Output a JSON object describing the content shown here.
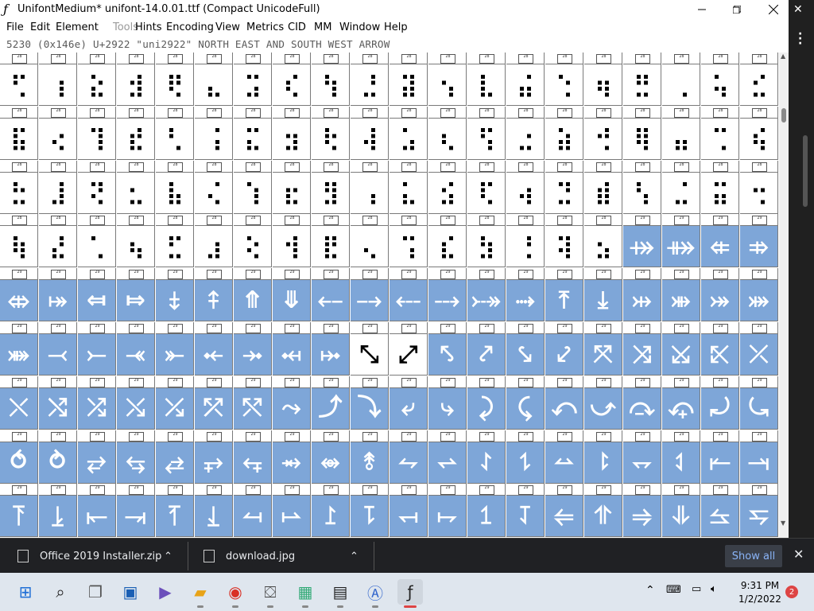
{
  "window": {
    "title": "UnifontMedium*  unifont-14.0.01.ttf (Compact UnicodeFull)",
    "app_icon": "fontforge-icon"
  },
  "menu": {
    "items": [
      {
        "label": "File",
        "enabled": true
      },
      {
        "label": "Edit",
        "enabled": true
      },
      {
        "label": "Element",
        "enabled": true
      },
      {
        "label": "Tools",
        "enabled": false
      },
      {
        "label": "Hints",
        "enabled": true
      },
      {
        "label": "Encoding",
        "enabled": true
      },
      {
        "label": "View",
        "enabled": true
      },
      {
        "label": "Metrics",
        "enabled": true
      },
      {
        "label": "CID",
        "enabled": true
      },
      {
        "label": "MM",
        "enabled": true
      },
      {
        "label": "Window",
        "enabled": true
      },
      {
        "label": "Help",
        "enabled": true
      }
    ]
  },
  "info": {
    "text": "5230 (0x146e) U+2922 \"uni2922\" NORTH EAST AND SOUTH WEST ARROW"
  },
  "grid": {
    "colors": {
      "defined_bg": "#ffffff",
      "empty_bg": "#7ea6d8",
      "border": "#7a7a7a"
    },
    "rows": [
      {
        "labels": [
          "28",
          "28",
          "28",
          "28",
          "28",
          "28",
          "28",
          "28",
          "28",
          "28",
          "28",
          "28",
          "28",
          "28",
          "28",
          "28",
          "28",
          "28",
          "28",
          "28"
        ],
        "kind": [
          "w",
          "w",
          "w",
          "w",
          "w",
          "w",
          "w",
          "w",
          "w",
          "w",
          "w",
          "w",
          "w",
          "w",
          "w",
          "w",
          "w",
          "w",
          "w",
          "w"
        ],
        "glyph": "braille"
      },
      {
        "labels": [
          "28",
          "28",
          "28",
          "28",
          "28",
          "28",
          "28",
          "28",
          "28",
          "28",
          "28",
          "28",
          "28",
          "28",
          "28",
          "28",
          "28",
          "28",
          "28",
          "28"
        ],
        "kind": [
          "w",
          "w",
          "w",
          "w",
          "w",
          "w",
          "w",
          "w",
          "w",
          "w",
          "w",
          "w",
          "w",
          "w",
          "w",
          "w",
          "w",
          "w",
          "w",
          "w"
        ],
        "glyph": "braille"
      },
      {
        "labels": [
          "28",
          "28",
          "28",
          "28",
          "28",
          "28",
          "28",
          "28",
          "28",
          "28",
          "28",
          "28",
          "28",
          "28",
          "28",
          "28",
          "28",
          "28",
          "28",
          "28"
        ],
        "kind": [
          "w",
          "w",
          "w",
          "w",
          "w",
          "w",
          "w",
          "w",
          "w",
          "w",
          "w",
          "w",
          "w",
          "w",
          "w",
          "w",
          "w",
          "w",
          "w",
          "w"
        ],
        "glyph": "braille"
      },
      {
        "labels": [
          "28",
          "28",
          "28",
          "28",
          "28",
          "28",
          "28",
          "28",
          "28",
          "28",
          "28",
          "28",
          "28",
          "28",
          "28",
          "28",
          "29",
          "29",
          "29",
          "29"
        ],
        "kind": [
          "w",
          "w",
          "w",
          "w",
          "w",
          "w",
          "w",
          "w",
          "w",
          "w",
          "w",
          "w",
          "w",
          "w",
          "w",
          "w",
          "b",
          "b",
          "b",
          "b"
        ],
        "glyph": "braille-then-arrows"
      },
      {
        "labels": [
          "29",
          "29",
          "29",
          "29",
          "29",
          "29",
          "29",
          "29",
          "29",
          "29",
          "29",
          "29",
          "29",
          "29",
          "29",
          "29",
          "29",
          "29",
          "29",
          "29"
        ],
        "kind": [
          "b",
          "b",
          "b",
          "b",
          "b",
          "b",
          "b",
          "b",
          "b",
          "b",
          "b",
          "b",
          "b",
          "b",
          "b",
          "b",
          "b",
          "b",
          "b",
          "b"
        ],
        "glyph": "arrows"
      },
      {
        "labels": [
          "29",
          "29",
          "29",
          "29",
          "29",
          "29",
          "29",
          "29",
          "29",
          "29",
          "29",
          "29",
          "29",
          "29",
          "29",
          "29",
          "29",
          "29",
          "29",
          "29"
        ],
        "kind": [
          "b",
          "b",
          "b",
          "b",
          "b",
          "b",
          "b",
          "b",
          "b",
          "w",
          "w",
          "b",
          "b",
          "b",
          "b",
          "b",
          "b",
          "b",
          "b",
          "b"
        ],
        "glyph": "arrows"
      },
      {
        "labels": [
          "29",
          "29",
          "29",
          "29",
          "29",
          "29",
          "29",
          "29",
          "29",
          "29",
          "29",
          "29",
          "29",
          "29",
          "29",
          "29",
          "29",
          "29",
          "29",
          "29"
        ],
        "kind": [
          "b",
          "b",
          "b",
          "b",
          "b",
          "b",
          "b",
          "b",
          "b",
          "b",
          "b",
          "b",
          "b",
          "b",
          "b",
          "b",
          "b",
          "b",
          "b",
          "b"
        ],
        "glyph": "arrows"
      },
      {
        "labels": [
          "29",
          "29",
          "29",
          "29",
          "29",
          "29",
          "29",
          "29",
          "29",
          "29",
          "29",
          "29",
          "29",
          "29",
          "29",
          "29",
          "29",
          "29",
          "29",
          "29"
        ],
        "kind": [
          "b",
          "b",
          "b",
          "b",
          "b",
          "b",
          "b",
          "b",
          "b",
          "b",
          "b",
          "b",
          "b",
          "b",
          "b",
          "b",
          "b",
          "b",
          "b",
          "b"
        ],
        "glyph": "arrows"
      },
      {
        "labels": [
          "29",
          "29",
          "29",
          "29",
          "29",
          "29",
          "29",
          "29",
          "29",
          "29",
          "29",
          "29",
          "29",
          "29",
          "29",
          "29",
          "29",
          "29",
          "29",
          "29"
        ],
        "kind": [
          "b",
          "b",
          "b",
          "b",
          "b",
          "b",
          "b",
          "b",
          "b",
          "b",
          "b",
          "b",
          "b",
          "b",
          "b",
          "b",
          "b",
          "b",
          "b",
          "b"
        ],
        "glyph": "arrows"
      }
    ],
    "arrow_rows": [
      [
        "",
        "",
        "",
        "",
        "",
        "",
        "",
        "",
        "",
        "",
        "",
        "",
        "",
        "",
        "",
        "",
        "⤀",
        "⤁",
        "⤂",
        "⤃"
      ],
      [
        "⤄",
        "⤅",
        "⤆",
        "⤇",
        "⤈",
        "⤉",
        "⤊",
        "⤋",
        "⤌",
        "⤍",
        "⤎",
        "⤏",
        "⤐",
        "⤑",
        "⤒",
        "⤓",
        "⤔",
        "⤕",
        "⤖",
        "⤗"
      ],
      [
        "⤘",
        "⤙",
        "⤚",
        "⤛",
        "⤜",
        "⤝",
        "⤞",
        "⤟",
        "⤠",
        "⤡",
        "⤢",
        "⤣",
        "⤤",
        "⤥",
        "⤦",
        "⤧",
        "⤨",
        "⤩",
        "⤪",
        "⤫"
      ],
      [
        "⤬",
        "⤭",
        "⤮",
        "⤯",
        "⤰",
        "⤱",
        "⤲",
        "⤳",
        "⤴",
        "⤵",
        "⤶",
        "⤷",
        "⤸",
        "⤹",
        "⤺",
        "⤻",
        "⤼",
        "⤽",
        "⤾",
        "⤿"
      ],
      [
        "⥀",
        "⥁",
        "⥂",
        "⥃",
        "⥄",
        "⥅",
        "⥆",
        "⥇",
        "⥈",
        "⥉",
        "⥊",
        "⥋",
        "⥌",
        "⥍",
        "⥎",
        "⥏",
        "⥐",
        "⥑",
        "⥒",
        "⥓"
      ],
      [
        "⥔",
        "⥕",
        "⥖",
        "⥗",
        "⥘",
        "⥙",
        "⥚",
        "⥛",
        "⥜",
        "⥝",
        "⥞",
        "⥟",
        "⥠",
        "⥡",
        "⥢",
        "⥣",
        "⥤",
        "⥥",
        "⥦",
        "⥧"
      ]
    ]
  },
  "downloads": {
    "items": [
      {
        "name": "Office 2019 Installer.zip",
        "icon": "zip-file-icon"
      },
      {
        "name": "download.jpg",
        "icon": "image-file-icon"
      }
    ],
    "show_all": "Show all"
  },
  "taskbar": {
    "icons": [
      "windows-start-icon",
      "search-icon",
      "task-view-icon",
      "widgets-icon",
      "teams-chat-icon",
      "file-explorer-icon",
      "chrome-icon",
      "store-icon",
      "app-installer-icon",
      "7zip-icon",
      "inkscape-icon",
      "fontforge-icon"
    ],
    "time": "9:31 PM",
    "date": "1/2/2022",
    "notifications": "2"
  }
}
